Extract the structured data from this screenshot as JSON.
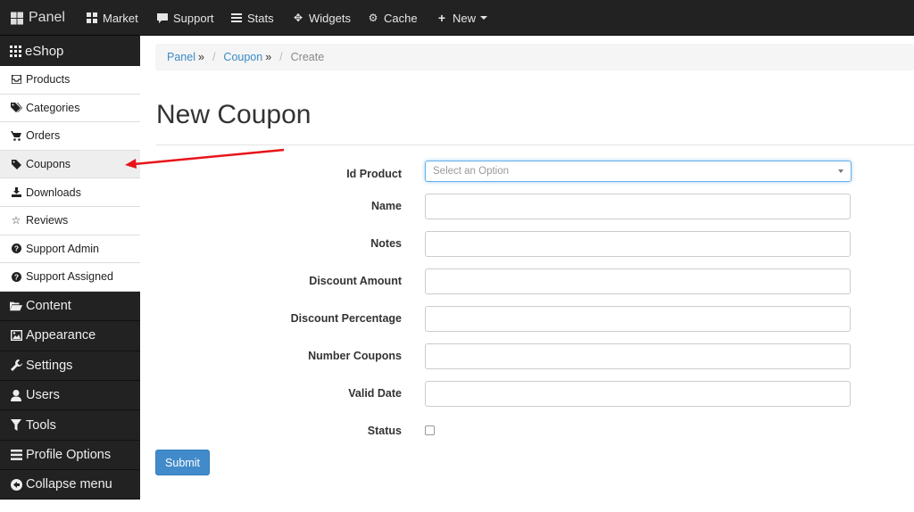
{
  "navbar": {
    "brand": "Panel",
    "brand_icon": "grid-icon",
    "items": [
      {
        "label": "Market",
        "icon": "market-icon"
      },
      {
        "label": "Support",
        "icon": "comment-icon"
      },
      {
        "label": "Stats",
        "icon": "stats-icon"
      },
      {
        "label": "Widgets",
        "icon": "move-icon"
      },
      {
        "label": "Cache",
        "icon": "cog-icon"
      },
      {
        "label": "New",
        "icon": "plus-icon"
      }
    ]
  },
  "sidebar": {
    "header": "eShop",
    "items": [
      {
        "label": "Products",
        "icon": "inbox-icon"
      },
      {
        "label": "Categories",
        "icon": "tags-icon"
      },
      {
        "label": "Orders",
        "icon": "cart-icon"
      },
      {
        "label": "Coupons",
        "icon": "tag-icon",
        "active": true
      },
      {
        "label": "Downloads",
        "icon": "download-icon"
      },
      {
        "label": "Reviews",
        "icon": "star-icon"
      },
      {
        "label": "Support Admin",
        "icon": "question-icon"
      },
      {
        "label": "Support Assigned",
        "icon": "question-icon"
      }
    ],
    "sections": [
      {
        "label": "Content",
        "icon": "folder-icon"
      },
      {
        "label": "Appearance",
        "icon": "picture-icon"
      },
      {
        "label": "Settings",
        "icon": "wrench-icon"
      },
      {
        "label": "Users",
        "icon": "user-icon"
      },
      {
        "label": "Tools",
        "icon": "filter-icon"
      },
      {
        "label": "Profile Options",
        "icon": "list-icon"
      },
      {
        "label": "Collapse menu",
        "icon": "circle-arrow-left-icon"
      }
    ]
  },
  "breadcrumb": {
    "items": [
      "Panel",
      "Coupon"
    ],
    "separator": "»",
    "current": "Create"
  },
  "page": {
    "title": "New Coupon"
  },
  "form": {
    "id_product": {
      "label": "Id Product",
      "placeholder": "Select an Option"
    },
    "fields": [
      {
        "label": "Name",
        "value": ""
      },
      {
        "label": "Notes",
        "value": ""
      },
      {
        "label": "Discount Amount",
        "value": ""
      },
      {
        "label": "Discount Percentage",
        "value": ""
      },
      {
        "label": "Number Coupons",
        "value": ""
      },
      {
        "label": "Valid Date",
        "value": ""
      }
    ],
    "status": {
      "label": "Status",
      "checked": false
    },
    "submit_label": "Submit"
  },
  "colors": {
    "navbar_bg": "#222222",
    "link": "#3a8ac6",
    "primary_button": "#428bca",
    "annotation_arrow": "#e8141a"
  }
}
